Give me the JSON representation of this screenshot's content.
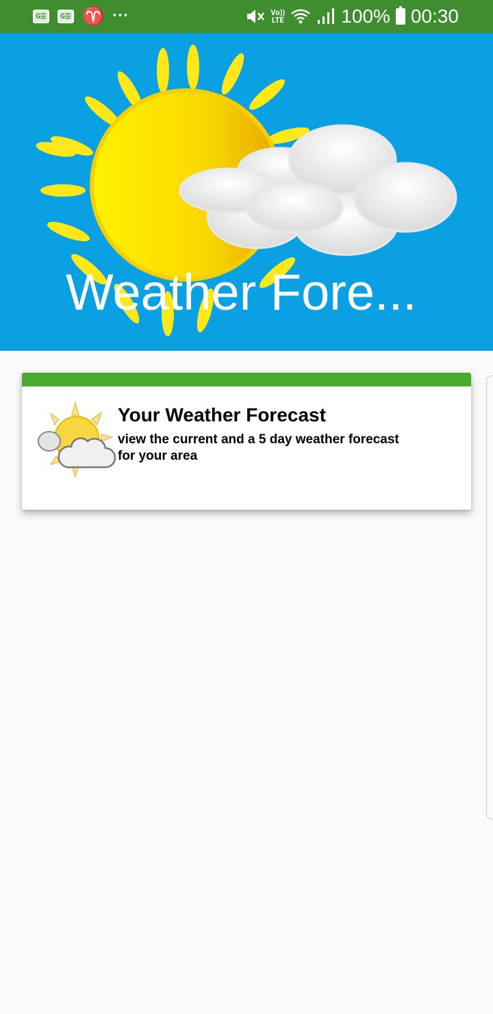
{
  "status_bar": {
    "notif_icons": [
      "G☰",
      "G☰"
    ],
    "battery": "100%",
    "time": "00:30",
    "volte": "Vo))",
    "lte": "LTE"
  },
  "header": {
    "title": "Weather Fore..."
  },
  "card": {
    "title": "Your Weather Forecast",
    "subtitle": "view the current and a 5 day weather forecast for your area",
    "accent_color": "#4aaa2f"
  },
  "colors": {
    "status_bar": "#3e8e2f",
    "header_bg": "#0aa0e2",
    "background": "#fafafa"
  }
}
